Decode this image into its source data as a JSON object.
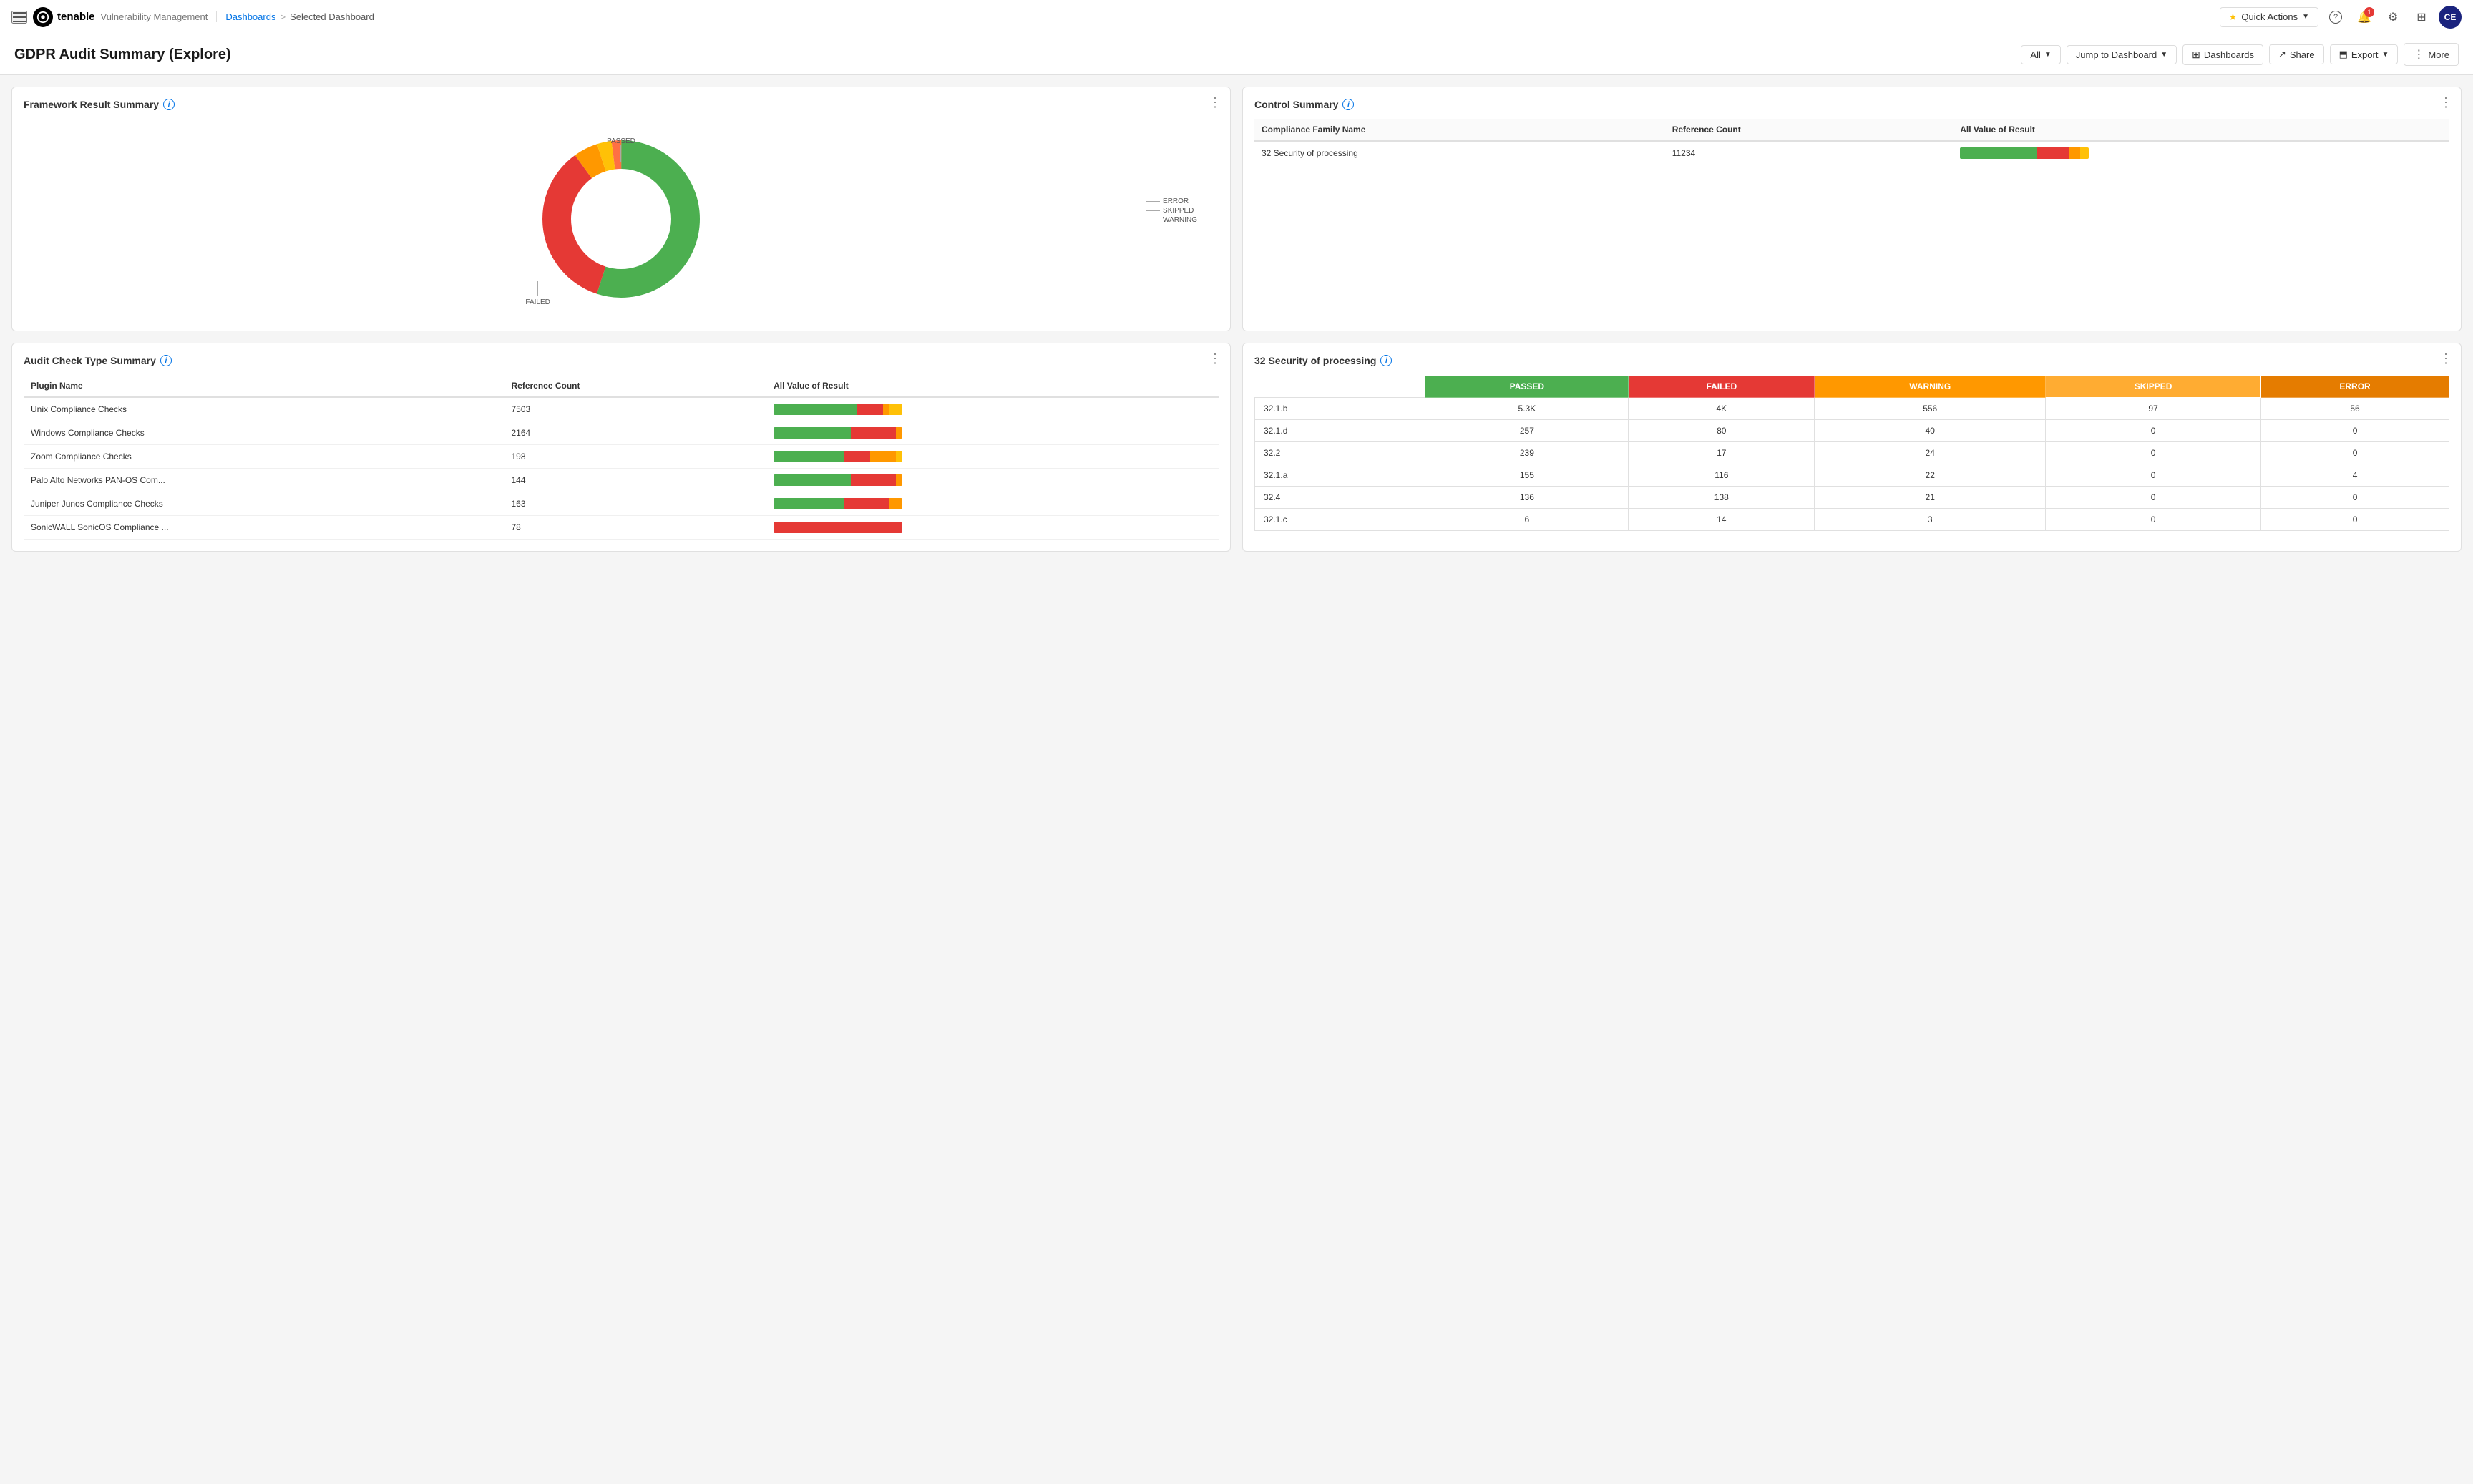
{
  "header": {
    "menu_icon": "☰",
    "logo_text": "tenable",
    "app_name": "Vulnerability Management",
    "breadcrumb_root": "Dashboards",
    "breadcrumb_sep": ">",
    "breadcrumb_current": "Selected Dashboard",
    "quick_actions_label": "Quick Actions",
    "help_icon": "?",
    "notifications_icon": "🔔",
    "notification_count": "1",
    "settings_icon": "⚙",
    "grid_icon": "⊞",
    "avatar_text": "CE"
  },
  "page": {
    "title": "GDPR Audit Summary (Explore)",
    "actions": {
      "all_label": "All",
      "jump_label": "Jump to Dashboard",
      "dashboards_label": "Dashboards",
      "share_label": "Share",
      "export_label": "Export",
      "more_label": "More"
    }
  },
  "framework_card": {
    "title": "Framework Result Summary",
    "menu_icon": "⋮",
    "donut": {
      "passed_label": "PASSED",
      "failed_label": "FAILED",
      "error_label": "ERROR",
      "skipped_label": "SKIPPED",
      "warning_label": "WARNING",
      "passed_pct": 55,
      "failed_pct": 35,
      "error_pct": 2,
      "skipped_pct": 3,
      "warning_pct": 5
    }
  },
  "control_summary_card": {
    "title": "Control Summary",
    "menu_icon": "⋮",
    "columns": [
      "Compliance Family Name",
      "Reference Count",
      "All Value of Result"
    ],
    "rows": [
      {
        "family": "32 Security of processing",
        "count": "11234",
        "bar": {
          "green": 60,
          "red": 25,
          "orange": 8,
          "yellow": 7
        }
      }
    ]
  },
  "audit_check_card": {
    "title": "Audit Check Type Summary",
    "menu_icon": "⋮",
    "columns": [
      "Plugin Name",
      "Reference Count",
      "All Value of Result"
    ],
    "rows": [
      {
        "plugin": "Unix Compliance Checks",
        "count": "7503",
        "bar": {
          "green": 65,
          "red": 20,
          "orange": 5,
          "yellow": 10
        }
      },
      {
        "plugin": "Windows Compliance Checks",
        "count": "2164",
        "bar": {
          "green": 60,
          "red": 35,
          "orange": 5,
          "yellow": 0
        }
      },
      {
        "plugin": "Zoom Compliance Checks",
        "count": "198",
        "bar": {
          "green": 55,
          "red": 20,
          "orange": 20,
          "yellow": 5
        }
      },
      {
        "plugin": "Palo Alto Networks PAN-OS Com...",
        "count": "144",
        "bar": {
          "green": 60,
          "red": 35,
          "orange": 5,
          "yellow": 0
        }
      },
      {
        "plugin": "Juniper Junos Compliance Checks",
        "count": "163",
        "bar": {
          "green": 55,
          "red": 35,
          "orange": 10,
          "yellow": 0
        }
      },
      {
        "plugin": "SonicWALL SonicOS Compliance ...",
        "count": "78",
        "bar": {
          "green": 0,
          "red": 100,
          "orange": 0,
          "yellow": 0
        }
      }
    ]
  },
  "security_processing_card": {
    "title": "32 Security of processing",
    "menu_icon": "⋮",
    "columns": [
      "",
      "PASSED",
      "FAILED",
      "WARNING",
      "SKIPPED",
      "ERROR"
    ],
    "rows": [
      {
        "label": "32.1.b",
        "passed": "5.3K",
        "failed": "4K",
        "warning": "556",
        "skipped": "97",
        "error": "56"
      },
      {
        "label": "32.1.d",
        "passed": "257",
        "failed": "80",
        "warning": "40",
        "skipped": "0",
        "error": "0"
      },
      {
        "label": "32.2",
        "passed": "239",
        "failed": "17",
        "warning": "24",
        "skipped": "0",
        "error": "0"
      },
      {
        "label": "32.1.a",
        "passed": "155",
        "failed": "116",
        "warning": "22",
        "skipped": "0",
        "error": "4"
      },
      {
        "label": "32.4",
        "passed": "136",
        "failed": "138",
        "warning": "21",
        "skipped": "0",
        "error": "0"
      },
      {
        "label": "32.1.c",
        "passed": "6",
        "failed": "14",
        "warning": "3",
        "skipped": "0",
        "error": "0"
      }
    ]
  }
}
